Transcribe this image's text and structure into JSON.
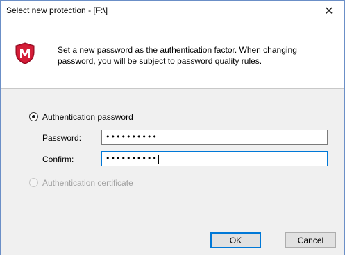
{
  "window": {
    "title": "Select new protection - [F:\\]",
    "close_glyph": "✕"
  },
  "header": {
    "logo_icon": "mcafee-shield-icon",
    "message": "Set a new password as the authentication factor. When changing password, you will be subject to password quality rules."
  },
  "options": {
    "password_option": {
      "label": "Authentication password",
      "selected": true,
      "enabled": true
    },
    "certificate_option": {
      "label": "Authentication certificate",
      "selected": false,
      "enabled": false
    }
  },
  "fields": {
    "password": {
      "label": "Password:",
      "value": "••••••••••"
    },
    "confirm": {
      "label": "Confirm:",
      "value": "••••••••••"
    }
  },
  "buttons": {
    "ok": "OK",
    "cancel": "Cancel"
  },
  "colors": {
    "brand_red": "#c8102e",
    "focus_blue": "#0078d7"
  }
}
